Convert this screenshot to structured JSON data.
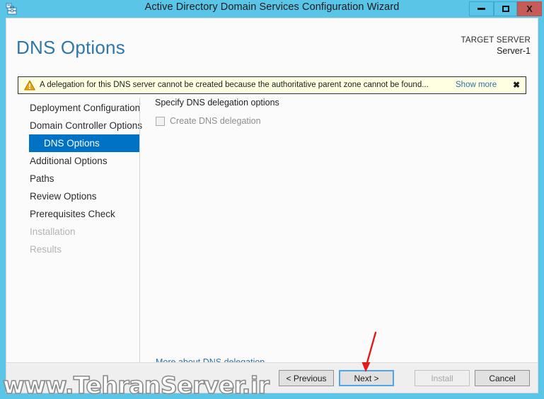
{
  "window": {
    "title": "Active Directory Domain Services Configuration Wizard",
    "icon": "server-manager-icon",
    "minimize_label": "–",
    "maximize_label": "□",
    "close_label": "X",
    "frame_color": "#5BC5E8",
    "accent_color": "#0072C6"
  },
  "header": {
    "page_title": "DNS Options",
    "target_server_label": "TARGET SERVER",
    "target_server_name": "Server-1"
  },
  "warning": {
    "icon": "warning-triangle-icon",
    "message": "A delegation for this DNS server cannot be created because the authoritative parent zone cannot be found...",
    "show_more_label": "Show more",
    "close_label": "✖",
    "background_color": "#FFFFE1",
    "icon_color": "#F0A30A"
  },
  "sidebar": {
    "items": [
      {
        "label": "Deployment Configuration",
        "state": "enabled"
      },
      {
        "label": "Domain Controller Options",
        "state": "enabled"
      },
      {
        "label": "DNS Options",
        "state": "selected"
      },
      {
        "label": "Additional Options",
        "state": "enabled"
      },
      {
        "label": "Paths",
        "state": "enabled"
      },
      {
        "label": "Review Options",
        "state": "enabled"
      },
      {
        "label": "Prerequisites Check",
        "state": "enabled"
      },
      {
        "label": "Installation",
        "state": "disabled"
      },
      {
        "label": "Results",
        "state": "disabled"
      }
    ]
  },
  "content": {
    "heading": "Specify DNS delegation options",
    "checkbox": {
      "label": "Create DNS delegation",
      "checked": false,
      "enabled": false
    },
    "more_link": "More about DNS delegation"
  },
  "footer": {
    "buttons": [
      {
        "label": "< Previous",
        "state": "enabled"
      },
      {
        "label": "Next >",
        "state": "focused"
      },
      {
        "label": "Install",
        "state": "disabled"
      },
      {
        "label": "Cancel",
        "state": "enabled"
      }
    ]
  },
  "annotations": {
    "arrow": {
      "color": "#E01B1B",
      "points_to": "Next >"
    },
    "watermark": "www.TehranServer.ir"
  }
}
